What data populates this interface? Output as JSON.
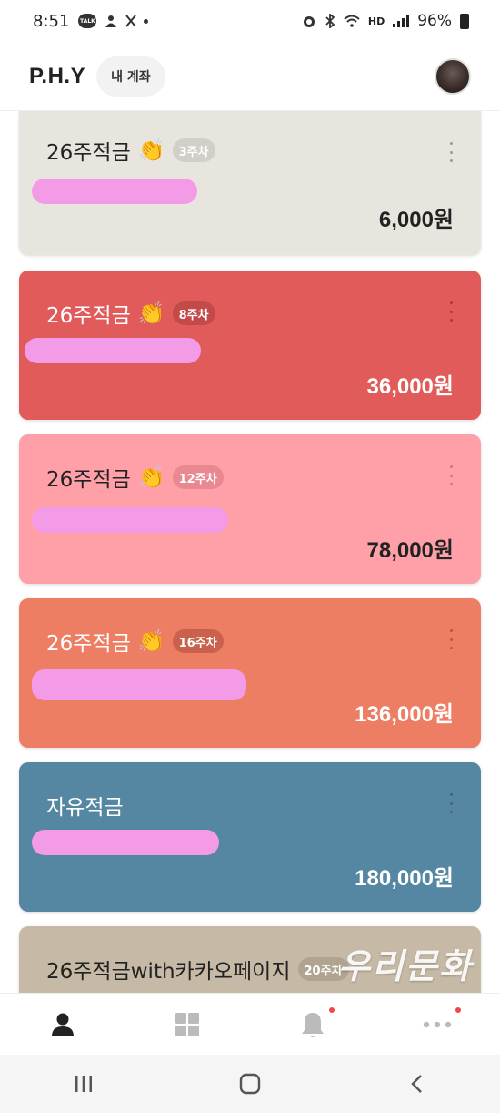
{
  "status_bar": {
    "time": "8:51",
    "talk_icon_label": "TALK",
    "battery": "96%",
    "hd_label": "HD"
  },
  "header": {
    "brand": "P.H.Y",
    "account_button": "내 계좌"
  },
  "cards": [
    {
      "title": "26주적금",
      "week_badge": "3주차",
      "amount": "6,000원",
      "background": "#e8e5de"
    },
    {
      "title": "26주적금",
      "week_badge": "8주차",
      "amount": "36,000원",
      "background": "#e25b5b"
    },
    {
      "title": "26주적금",
      "week_badge": "12주차",
      "amount": "78,000원",
      "background": "#ffa0a9"
    },
    {
      "title": "26주적금",
      "week_badge": "16주차",
      "amount": "136,000원",
      "background": "#ed7d63"
    },
    {
      "title": "자유적금",
      "amount": "180,000원",
      "background": "#5587a3"
    },
    {
      "title": "26주적금with카카오페이지",
      "week_badge": "20주차",
      "background": "#c6baa6"
    }
  ],
  "watermark": "우리문화",
  "bottom_nav": {
    "items": [
      {
        "icon": "person-icon",
        "active": true
      },
      {
        "icon": "grid-icon",
        "active": false
      },
      {
        "icon": "bell-icon",
        "active": false,
        "notification": true
      },
      {
        "icon": "more-horizontal-icon",
        "active": false,
        "notification": true
      }
    ]
  },
  "system_nav": [
    "recent-apps-icon",
    "home-icon",
    "back-icon"
  ],
  "colors": {
    "accent_red_dot": "#f04848",
    "redaction": "#f49be8"
  }
}
